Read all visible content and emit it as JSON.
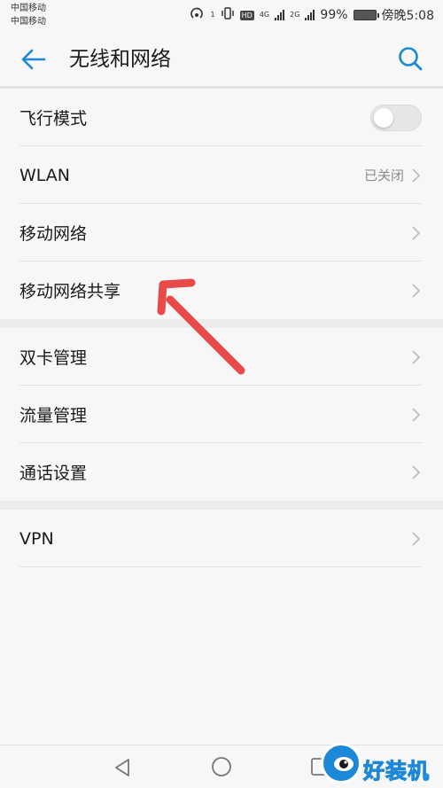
{
  "status_bar": {
    "carrier_1": "中国移动",
    "carrier_2": "中国移动",
    "sim1_tag": "1",
    "hd_label": "HD",
    "net_4g": "4G",
    "net_2g": "2G",
    "battery": "99%",
    "time": "傍晚5:08"
  },
  "header": {
    "title": "无线和网络",
    "back_icon": "arrow-left-icon",
    "search_icon": "search-icon"
  },
  "sections": [
    {
      "items": [
        {
          "label": "飞行模式",
          "type": "toggle",
          "toggle_on": false
        },
        {
          "label": "WLAN",
          "value": "已关闭",
          "type": "chevron"
        },
        {
          "label": "移动网络",
          "type": "chevron"
        },
        {
          "label": "移动网络共享",
          "type": "chevron"
        }
      ]
    },
    {
      "items": [
        {
          "label": "双卡管理",
          "type": "chevron"
        },
        {
          "label": "流量管理",
          "type": "chevron"
        },
        {
          "label": "通话设置",
          "type": "chevron"
        }
      ]
    },
    {
      "items": [
        {
          "label": "VPN",
          "type": "chevron"
        }
      ]
    }
  ],
  "navbar": {
    "back": "triangle-back-icon",
    "home": "circle-home-icon",
    "recent": "square-recent-icon"
  },
  "watermark": {
    "text": "好装机"
  },
  "colors": {
    "accent": "#1e88d8",
    "annotation_arrow": "#e84a4a",
    "background": "#f7f7f7"
  }
}
